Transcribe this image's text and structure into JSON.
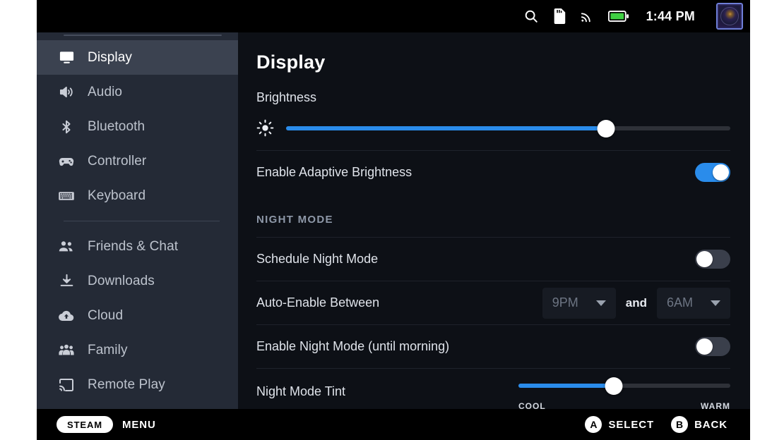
{
  "statusbar": {
    "icons": [
      "search-icon",
      "sd-card-icon",
      "wifi-icon",
      "battery-icon"
    ],
    "time": "1:44 PM",
    "battery_color": "#3fd143",
    "avatar_alt": "user-avatar"
  },
  "sidebar": {
    "items": [
      {
        "label": "Display",
        "icon": "monitor-icon",
        "selected": true
      },
      {
        "label": "Audio",
        "icon": "speaker-icon",
        "selected": false
      },
      {
        "label": "Bluetooth",
        "icon": "bluetooth-icon",
        "selected": false
      },
      {
        "label": "Controller",
        "icon": "gamepad-icon",
        "selected": false
      },
      {
        "label": "Keyboard",
        "icon": "keyboard-icon",
        "selected": false
      },
      {
        "label": "Friends & Chat",
        "icon": "friends-icon",
        "selected": false
      },
      {
        "label": "Downloads",
        "icon": "download-icon",
        "selected": false
      },
      {
        "label": "Cloud",
        "icon": "cloud-icon",
        "selected": false
      },
      {
        "label": "Family",
        "icon": "family-icon",
        "selected": false
      },
      {
        "label": "Remote Play",
        "icon": "remote-play-icon",
        "selected": false
      }
    ],
    "separator_after_index": 4
  },
  "main": {
    "title": "Display",
    "brightness": {
      "label": "Brightness",
      "icon": "brightness-sun-icon",
      "value_percent": 72
    },
    "adaptive_brightness": {
      "label": "Enable Adaptive Brightness",
      "state": "on"
    },
    "night_mode": {
      "section_title": "NIGHT MODE",
      "schedule": {
        "label": "Schedule Night Mode",
        "state": "off"
      },
      "auto_enable": {
        "label": "Auto-Enable Between",
        "start_value": "9PM",
        "conjunction": "and",
        "end_value": "6AM"
      },
      "enable_until_morning": {
        "label": "Enable Night Mode (until morning)",
        "state": "off"
      },
      "tint": {
        "label": "Night Mode Tint",
        "min_label": "COOL",
        "max_label": "WARM",
        "value_percent": 45
      }
    }
  },
  "bottombar": {
    "steam_pill": "STEAM",
    "menu_label": "MENU",
    "hints": [
      {
        "button": "A",
        "action": "SELECT"
      },
      {
        "button": "B",
        "action": "BACK"
      }
    ]
  },
  "colors": {
    "accent": "#2a8ceb",
    "sidebar_bg": "#242a36",
    "sidebar_selected": "#3b4250",
    "content_bg": "#0d1016",
    "bar_bg": "#000000"
  }
}
